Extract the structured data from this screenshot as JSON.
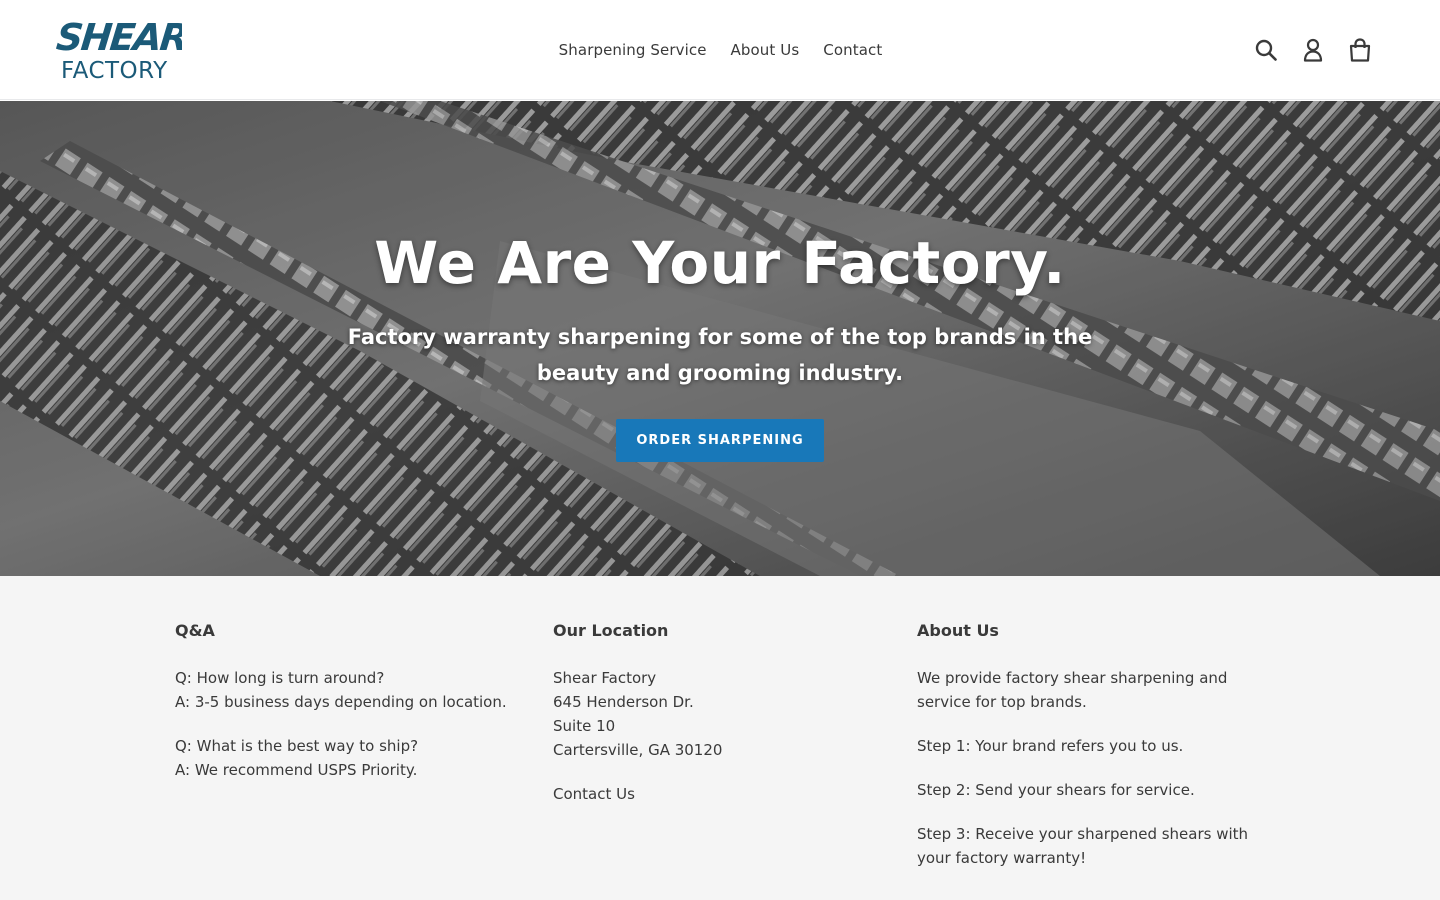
{
  "brand": {
    "logo_line1": "SHEAR",
    "logo_line2": "FACTORY",
    "logo_color": "#1b5a78"
  },
  "nav": {
    "items": [
      {
        "label": "Sharpening Service"
      },
      {
        "label": "About Us"
      },
      {
        "label": "Contact"
      }
    ]
  },
  "header_icons": [
    "search-icon",
    "account-icon",
    "cart-icon"
  ],
  "hero": {
    "title": "We Are Your Factory.",
    "subtitle": "Factory warranty sharpening for some of the top brands in the beauty and grooming industry.",
    "button_label": "ORDER SHARPENING",
    "button_color": "#1878b9"
  },
  "footer": {
    "qa": {
      "heading": "Q&A",
      "items": [
        {
          "q": "Q: How long is turn around?",
          "a": "A: 3-5 business days depending on location."
        },
        {
          "q": "Q: What is the best way to ship?",
          "a": "A: We recommend USPS Priority."
        }
      ]
    },
    "location": {
      "heading": "Our Location",
      "lines": [
        "Shear Factory",
        "645 Henderson Dr.",
        "Suite 10",
        "Cartersville, GA 30120"
      ],
      "contact_link": "Contact Us"
    },
    "about": {
      "heading": "About Us",
      "paragraphs": [
        "We provide factory shear sharpening and service for top brands.",
        "Step 1: Your brand refers you to us.",
        "Step 2: Send your shears for service.",
        "Step 3: Receive your sharpened shears with your factory warranty!"
      ]
    }
  }
}
